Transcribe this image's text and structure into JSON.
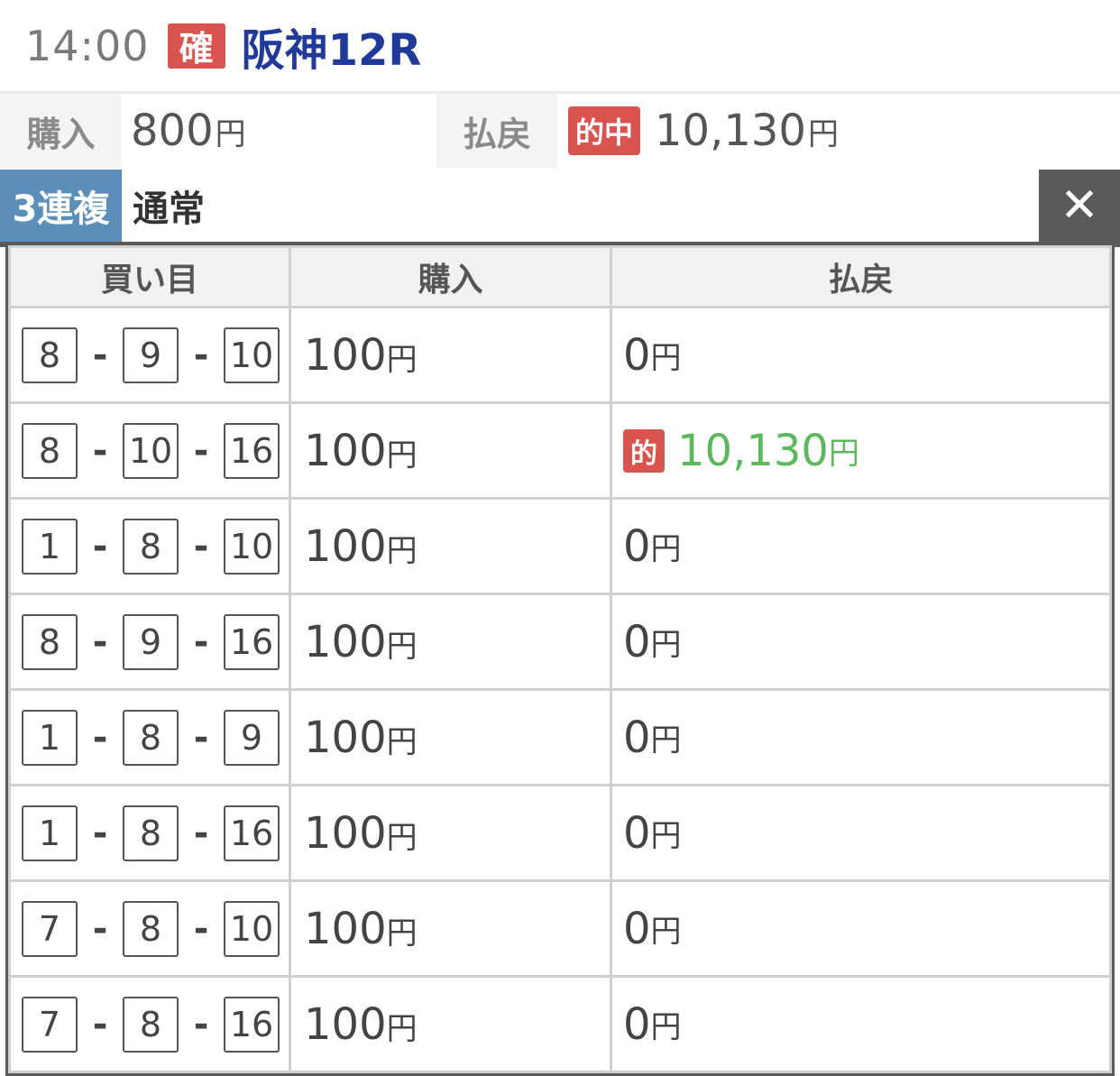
{
  "header": {
    "time": "14:00",
    "status_badge": "確",
    "race": "阪神12R"
  },
  "summary": {
    "purchase_label": "購入",
    "purchase_amount": "800",
    "purchase_unit": "円",
    "payout_label": "払戻",
    "hit_badge": "的中",
    "payout_amount": "10,130",
    "payout_unit": "円"
  },
  "bet": {
    "type": "3連複",
    "mode": "通常",
    "close": "✕"
  },
  "table": {
    "headers": [
      "買い目",
      "購入",
      "払戻"
    ],
    "rows": [
      {
        "a": "8",
        "b": "9",
        "c": "10",
        "buy": "100",
        "pay": "0"
      },
      {
        "a": "8",
        "b": "10",
        "c": "16",
        "buy": "100",
        "pay": "10,130",
        "badge": "的"
      },
      {
        "a": "1",
        "b": "8",
        "c": "10",
        "buy": "100",
        "pay": "0"
      },
      {
        "a": "8",
        "b": "9",
        "c": "16",
        "buy": "100",
        "pay": "0"
      },
      {
        "a": "1",
        "b": "8",
        "c": "9",
        "buy": "100",
        "pay": "0"
      },
      {
        "a": "1",
        "b": "8",
        "c": "16",
        "buy": "100",
        "pay": "0"
      },
      {
        "a": "7",
        "b": "8",
        "c": "10",
        "buy": "100",
        "pay": "0"
      },
      {
        "a": "7",
        "b": "8",
        "c": "16",
        "buy": "100",
        "pay": "0"
      }
    ],
    "dash": "-",
    "yen": "円"
  },
  "colors": {
    "badge_red": "#d9534f",
    "race_blue": "#1f3a99",
    "type_blue": "#5b8fb9",
    "win_green": "#5cb85c"
  }
}
